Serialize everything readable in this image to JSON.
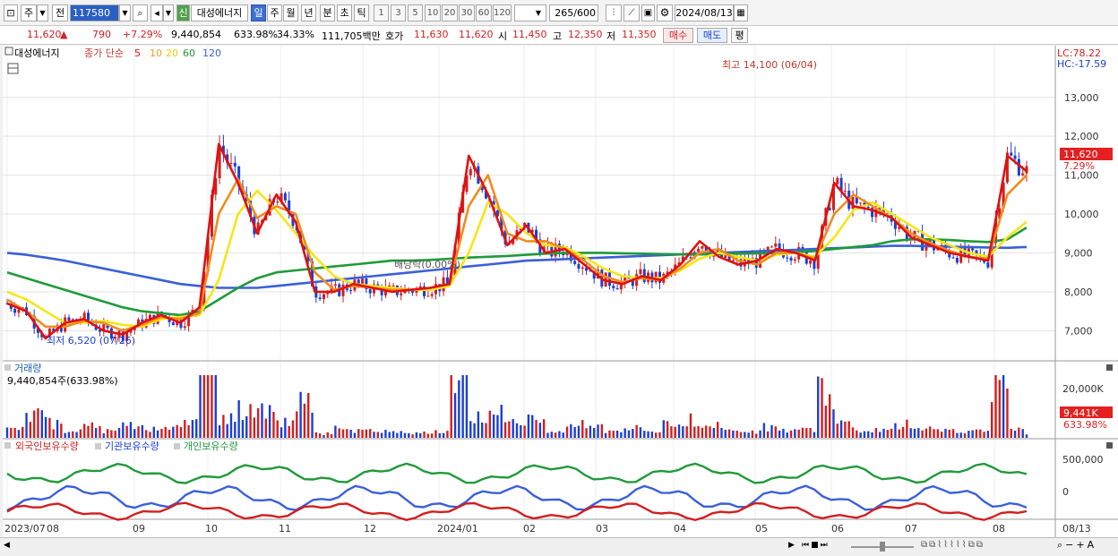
{
  "toolbar": {
    "period_type": "주",
    "compare": "전",
    "code": "117580",
    "new_badge": "신",
    "stock_name": "대성에너지",
    "periods": [
      "일",
      "주",
      "월",
      "년",
      "분",
      "초",
      "틱"
    ],
    "intervals": [
      "1",
      "3",
      "5",
      "10",
      "20",
      "30",
      "60",
      "120"
    ],
    "count": "265",
    "count_max": "/600",
    "date": "2024/08/13"
  },
  "quote": {
    "price": "11,620",
    "change": "790",
    "change_pct": "+7.29%",
    "volume": "9,440,854",
    "volume_ratio": "633.98%",
    "turnover": "34.33%",
    "amount": "111,705백만",
    "bid_label": "호가",
    "bid": "11,630",
    "ask": "11,620",
    "open_label": "시",
    "open": "11,450",
    "high_label": "고",
    "high": "12,350",
    "low_label": "저",
    "low": "11,350",
    "buy": "매수",
    "sell": "매도",
    "eval": "평"
  },
  "legend": {
    "name": "대성에너지",
    "type": "종가 단순",
    "ma": [
      "5",
      "10",
      "20",
      "60",
      "120"
    ],
    "lc": "LC:78.22",
    "hc": "HC:-17.59"
  },
  "annotations": {
    "high": "최고 14,100 (06/04)",
    "low": "최저 6,520 (07/26)",
    "dividend": "배당락(0.00%)"
  },
  "price_axis": [
    "13,000",
    "12,000",
    "11,000",
    "10,000",
    "9,000",
    "8,000",
    "7,000"
  ],
  "last_price_tag": {
    "price": "11,620",
    "pct": "7.29%"
  },
  "volume_panel": {
    "title": "거래량",
    "value": "9,440,854주(633.98%)",
    "axis": "20,000K",
    "last": "9,441K",
    "last_pct": "633.98%"
  },
  "holder_panel": {
    "foreign": "외국인보유수량",
    "inst": "기관보유수량",
    "indiv": "개인보유수량",
    "axis": [
      "500,000",
      "0"
    ]
  },
  "x_axis": [
    "2023/07",
    "08",
    "09",
    "10",
    "11",
    "12",
    "2024/01",
    "02",
    "03",
    "04",
    "05",
    "06",
    "07",
    "08",
    "08/13"
  ],
  "colors": {
    "up": "#d21f1f",
    "down": "#1a3fd3",
    "ma5": "#e01010",
    "ma10": "#f08c1e",
    "ma20": "#f5e617",
    "ma60": "#1f9a3a",
    "ma120": "#3a5fd9"
  },
  "chart_data": {
    "type": "candlestick",
    "ylim": [
      6500,
      14100
    ],
    "months": [
      "2023/07",
      "08",
      "09",
      "10",
      "11",
      "12",
      "2024/01",
      "02",
      "03",
      "04",
      "05",
      "06",
      "07",
      "08"
    ],
    "series": [
      {
        "name": "5",
        "values": [
          7700,
          7500,
          6800,
          7200,
          7300,
          7000,
          6900,
          7200,
          7400,
          7200,
          7600,
          11800,
          10800,
          9500,
          10500,
          9800,
          8000,
          8000,
          8200,
          8100,
          8000,
          8050,
          8100,
          8200,
          11500,
          10500,
          9200,
          9700,
          9000,
          9100,
          8700,
          8300,
          8200,
          8400,
          8300,
          8700,
          9300,
          8900,
          8700,
          8800,
          9100,
          9000,
          8800,
          10800,
          10200,
          10100,
          9900,
          9400,
          9200,
          9000,
          8900,
          8800,
          11500,
          11100
        ]
      },
      {
        "name": "10",
        "values": [
          7800,
          7500,
          7100,
          7100,
          7250,
          7200,
          7000,
          7150,
          7350,
          7300,
          7450,
          10000,
          10900,
          9900,
          10200,
          10000,
          8500,
          8050,
          8150,
          8100,
          8050,
          8050,
          8100,
          8200,
          10200,
          11000,
          9500,
          9300,
          9300,
          9100,
          8800,
          8400,
          8250,
          8350,
          8300,
          8600,
          9000,
          9100,
          8800,
          8700,
          9000,
          9000,
          8850,
          10000,
          10500,
          10200,
          9900,
          9500,
          9250,
          9050,
          8900,
          8850,
          10500,
          11000
        ]
      },
      {
        "name": "20",
        "values": [
          8000,
          7800,
          7500,
          7200,
          7200,
          7250,
          7150,
          7100,
          7300,
          7350,
          7400,
          8300,
          10000,
          10600,
          10100,
          9500,
          8900,
          8400,
          8200,
          8150,
          8100,
          8050,
          8050,
          8150,
          9000,
          10300,
          10000,
          9500,
          9200,
          9150,
          8900,
          8600,
          8400,
          8350,
          8350,
          8550,
          8850,
          9000,
          8900,
          8800,
          8950,
          9000,
          8900,
          9400,
          10100,
          10300,
          10000,
          9700,
          9400,
          9200,
          9000,
          8900,
          9400,
          9800
        ]
      },
      {
        "name": "60",
        "values": [
          8500,
          8350,
          8200,
          8050,
          7900,
          7750,
          7600,
          7500,
          7450,
          7400,
          7500,
          7800,
          8100,
          8350,
          8500,
          8550,
          8600,
          8650,
          8700,
          8750,
          8800,
          8800,
          8820,
          8850,
          8880,
          8900,
          8920,
          8950,
          8980,
          9000,
          9000,
          9000,
          8990,
          8980,
          8970,
          8960,
          8960,
          8970,
          8980,
          8990,
          9000,
          9020,
          9050,
          9100,
          9150,
          9200,
          9300,
          9350,
          9350,
          9330,
          9300,
          9280,
          9350,
          9650
        ]
      },
      {
        "name": "120",
        "values": [
          9000,
          8950,
          8880,
          8800,
          8700,
          8600,
          8500,
          8400,
          8300,
          8200,
          8150,
          8100,
          8100,
          8100,
          8150,
          8200,
          8250,
          8300,
          8350,
          8400,
          8450,
          8500,
          8550,
          8600,
          8650,
          8700,
          8750,
          8800,
          8820,
          8840,
          8860,
          8880,
          8900,
          8920,
          8940,
          8960,
          8980,
          9000,
          9020,
          9040,
          9060,
          9080,
          9100,
          9120,
          9140,
          9160,
          9180,
          9180,
          9170,
          9160,
          9150,
          9140,
          9130,
          9150
        ]
      }
    ]
  }
}
